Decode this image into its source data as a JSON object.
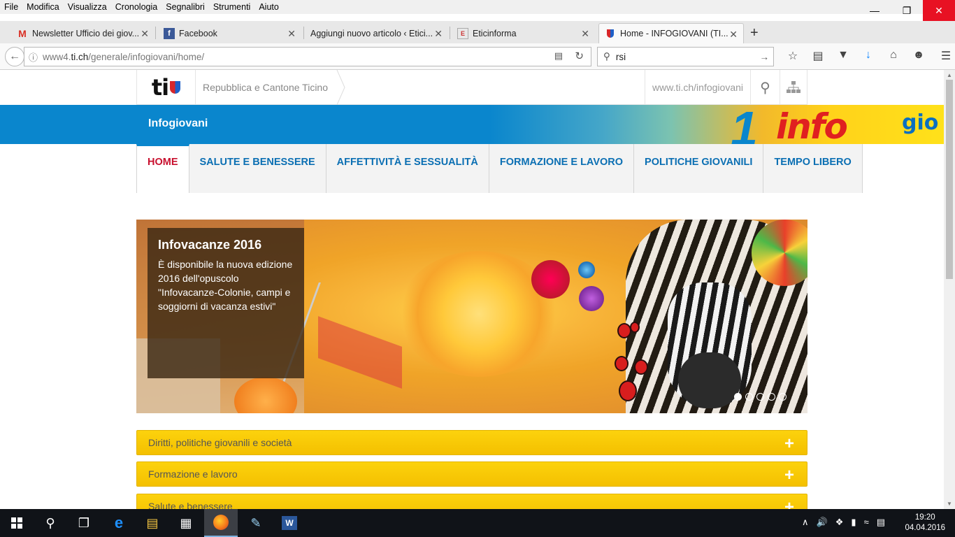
{
  "browser": {
    "menu": [
      "File",
      "Modifica",
      "Visualizza",
      "Cronologia",
      "Segnalibri",
      "Strumenti",
      "Aiuto"
    ],
    "tabs": [
      {
        "title": "Newsletter Ufficio dei giov...",
        "icon": "gmail-icon"
      },
      {
        "title": "Facebook",
        "icon": "facebook-icon"
      },
      {
        "title": "Aggiungi nuovo articolo ‹ Etici...",
        "icon": "none"
      },
      {
        "title": "Eticinforma",
        "icon": "eticinforma-icon"
      },
      {
        "title": "Home - INFOGIOVANI (TI...",
        "icon": "ticino-shield-icon"
      }
    ],
    "url_prefix": "www4.",
    "url_domain": "ti.ch",
    "url_path": "/generale/infogiovani/home/",
    "search_value": "rsi"
  },
  "site": {
    "brand": "ti",
    "canton": "Repubblica e Cantone Ticino",
    "site_link": "www.ti.ch/infogiovani",
    "banner_title": "Infogiovani",
    "banner_art_text": "info",
    "banner_art_text2": "gio",
    "nav": [
      {
        "label": "HOME",
        "active": true
      },
      {
        "label": "SALUTE E BENESSERE",
        "active": false
      },
      {
        "label": "AFFETTIVITÀ E SESSUALITÀ",
        "active": false
      },
      {
        "label": "FORMAZIONE E LAVORO",
        "active": false
      },
      {
        "label": "POLITICHE GIOVANILI",
        "active": false
      },
      {
        "label": "TEMPO LIBERO",
        "active": false
      }
    ],
    "slide": {
      "title": "Infovacanze 2016",
      "text": "È disponibile la nuova edizione 2016 dell'opuscolo \"Infovacanze-Colonie, campi e soggiorni di vacanza estivi\"",
      "dots_total": 5,
      "dot_active": 1
    },
    "accordion": [
      "Diritti, politiche giovanili e società",
      "Formazione e lavoro",
      "Salute e benessere"
    ]
  },
  "taskbar": {
    "time": "19:20",
    "date": "04.04.2016"
  },
  "colors": {
    "banner_blue": "#0a86cd",
    "nav_text": "#0b6fb3",
    "nav_active": "#c8102e",
    "accordion_yellow": "#fcd20d"
  }
}
